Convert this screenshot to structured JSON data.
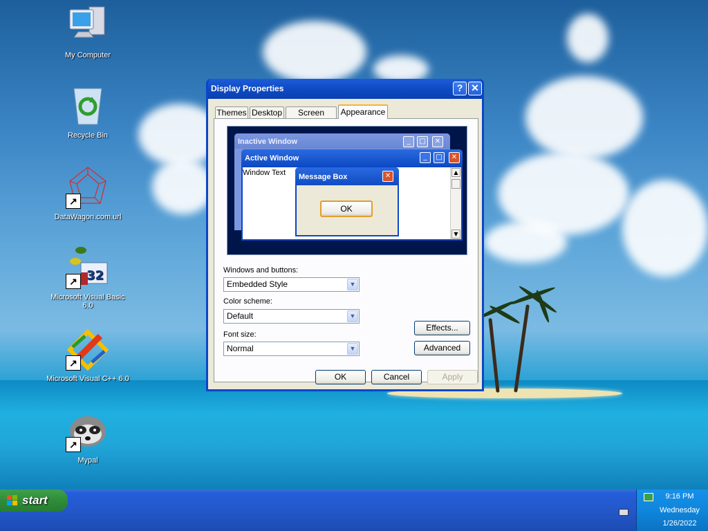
{
  "desktop": {
    "icons": [
      {
        "label": "My Computer",
        "icon": "computer-icon"
      },
      {
        "label": "Recycle Bin",
        "icon": "recycle-bin-icon"
      },
      {
        "label": "DataWagon.com.url",
        "icon": "internet-shortcut-icon"
      },
      {
        "label": "Microsoft Visual Basic 6.0",
        "icon": "visual-basic-icon"
      },
      {
        "label": "Microsoft Visual C++ 6.0",
        "icon": "visual-cpp-icon"
      },
      {
        "label": "Mypal",
        "icon": "mypal-browser-icon"
      }
    ]
  },
  "dialog": {
    "title": "Display Properties",
    "help_glyph": "?",
    "close_glyph": "✕",
    "tabs": [
      {
        "label": "Themes",
        "active": false
      },
      {
        "label": "Desktop",
        "active": false
      },
      {
        "label": "Screen Saver",
        "active": false
      },
      {
        "label": "Appearance",
        "active": true
      }
    ],
    "preview": {
      "inactive_title": "Inactive Window",
      "active_title": "Active Window",
      "window_text": "Window Text",
      "message_box_title": "Message Box",
      "ok_label": "OK"
    },
    "windows_buttons_label": "Windows and buttons:",
    "windows_buttons_value": "Embedded Style",
    "color_scheme_label": "Color scheme:",
    "color_scheme_value": "Default",
    "font_size_label": "Font size:",
    "font_size_value": "Normal",
    "effects_label": "Effects...",
    "advanced_label": "Advanced",
    "ok_label": "OK",
    "cancel_label": "Cancel",
    "apply_label": "Apply"
  },
  "taskbar": {
    "start_label": "start",
    "time": "9:16 PM",
    "day": "Wednesday",
    "date": "1/26/2022"
  },
  "colors": {
    "title_blue": "#0a47c8",
    "start_green": "#2f8c3a",
    "taskbar_blue": "#245edb",
    "tray_blue": "#0f86dc",
    "dialog_face": "#ece9d8"
  }
}
